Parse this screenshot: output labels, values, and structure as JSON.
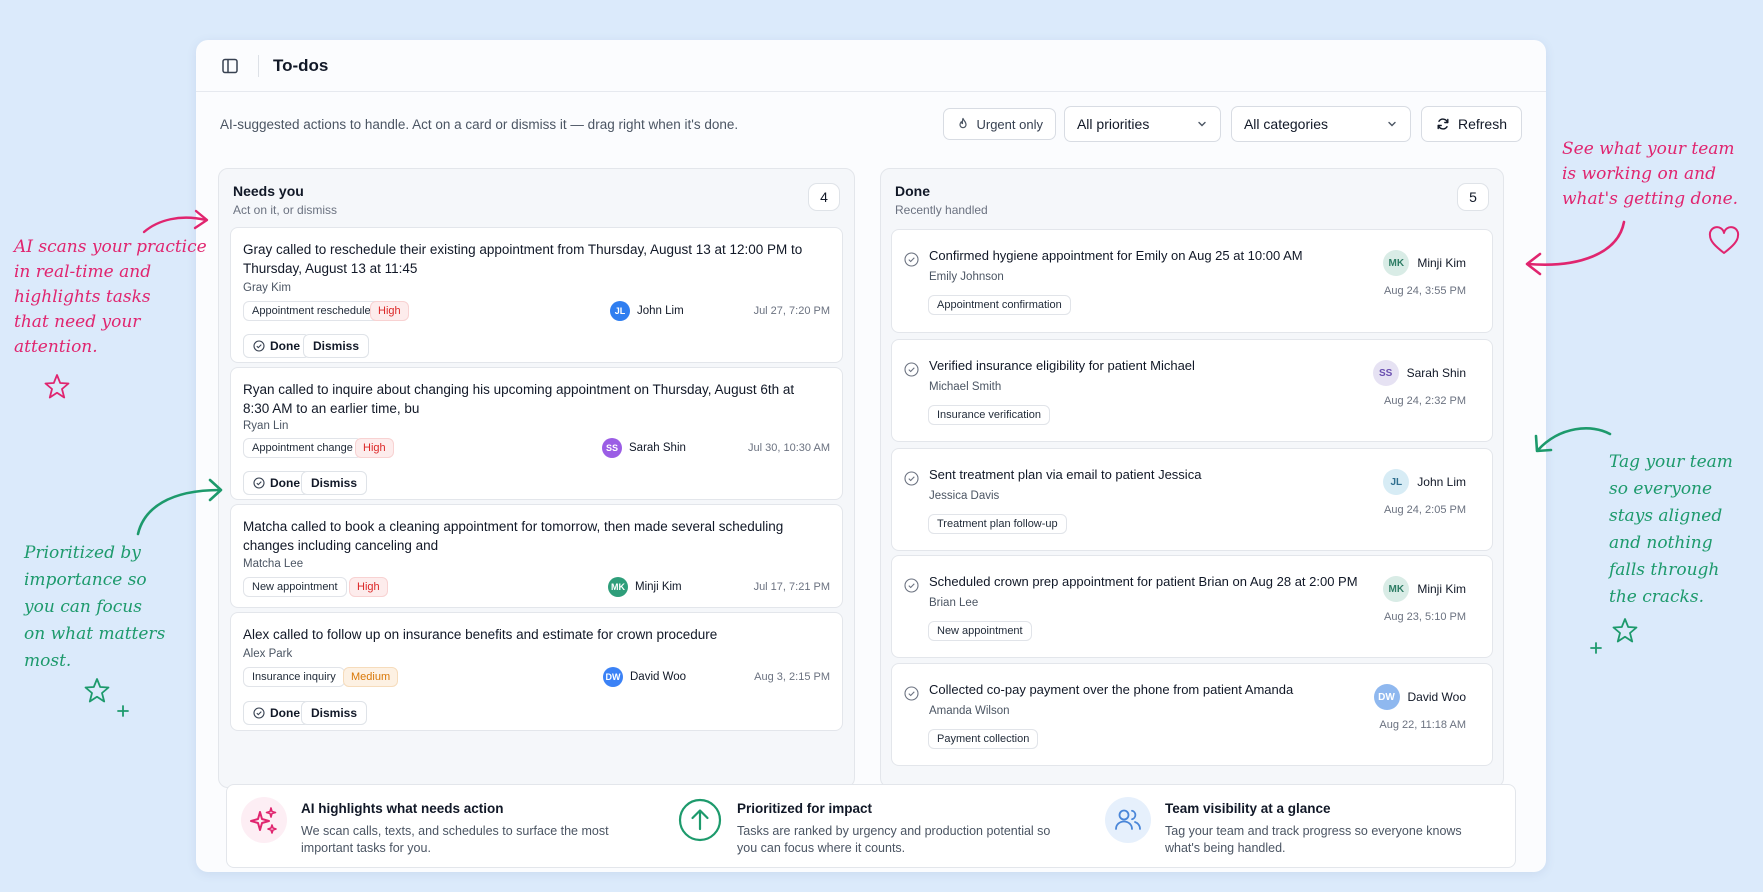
{
  "header": {
    "title": "To-dos"
  },
  "toolbar": {
    "subtitle": "AI-suggested actions to handle. Act on a card or dismiss it — drag right when it's done.",
    "urgent_label": "Urgent only",
    "priorities_value": "All priorities",
    "categories_value": "All categories",
    "refresh_label": "Refresh"
  },
  "needs_you": {
    "title": "Needs you",
    "subtitle": "Act on it, or dismiss",
    "count": "4",
    "done_label": "Done",
    "dismiss_label": "Dismiss",
    "cards": [
      {
        "text": "Gray called to reschedule their existing appointment from Thursday, August 13 at 12:00 PM to Thursday, August 13 at 11:45",
        "person": "Gray Kim",
        "tag": "Appointment reschedule",
        "priority": "High",
        "assignee": "John Lim",
        "initials": "JL",
        "time": "Jul 27, 7:20 PM"
      },
      {
        "text": "Ryan called to inquire about changing his upcoming appointment on Thursday, August 6th at 8:30 AM to an earlier time, bu",
        "person": "Ryan Lin",
        "tag": "Appointment change",
        "priority": "High",
        "assignee": "Sarah Shin",
        "initials": "SS",
        "time": "Jul 30, 10:30 AM"
      },
      {
        "text": "Matcha called to book a cleaning appointment for tomorrow, then made several scheduling changes including canceling and",
        "person": "Matcha Lee",
        "tag": "New appointment",
        "priority": "High",
        "assignee": "Minji Kim",
        "initials": "MK",
        "time": "Jul 17, 7:21 PM"
      },
      {
        "text": "Alex called to follow up on insurance benefits and estimate for crown procedure",
        "person": "Alex Park",
        "tag": "Insurance inquiry",
        "priority": "Medium",
        "assignee": "David Woo",
        "initials": "DW",
        "time": "Aug 3, 2:15 PM"
      }
    ]
  },
  "done": {
    "title": "Done",
    "subtitle": "Recently handled",
    "count": "5",
    "cards": [
      {
        "text": "Confirmed hygiene appointment for Emily on Aug 25 at 10:00 AM",
        "person": "Emily Johnson",
        "tag": "Appointment confirmation",
        "assignee": "Minji Kim",
        "initials": "MK",
        "time": "Aug 24, 3:55 PM"
      },
      {
        "text": "Verified insurance eligibility for patient Michael",
        "person": "Michael Smith",
        "tag": "Insurance verification",
        "assignee": "Sarah Shin",
        "initials": "SS",
        "time": "Aug 24, 2:32 PM"
      },
      {
        "text": "Sent treatment plan via email to patient Jessica",
        "person": "Jessica Davis",
        "tag": "Treatment plan follow-up",
        "assignee": "John Lim",
        "initials": "JL",
        "time": "Aug 24, 2:05 PM"
      },
      {
        "text": "Scheduled crown prep appointment for patient Brian on Aug 28 at 2:00 PM",
        "person": "Brian Lee",
        "tag": "New appointment",
        "assignee": "Minji Kim",
        "initials": "MK",
        "time": "Aug 23, 5:10 PM"
      },
      {
        "text": "Collected co-pay payment over the phone from patient Amanda",
        "person": "Amanda Wilson",
        "tag": "Payment collection",
        "assignee": "David Woo",
        "initials": "DW",
        "time": "Aug 22, 11:18 AM"
      }
    ]
  },
  "features": [
    {
      "title": "AI highlights what needs action",
      "desc": "We scan calls, texts, and schedules to surface the most important tasks for you.",
      "icon": "sparkles-icon"
    },
    {
      "title": "Prioritized for impact",
      "desc": "Tasks are ranked by urgency and production potential so you can focus where it counts.",
      "icon": "arrow-up-circle-icon"
    },
    {
      "title": "Team visibility at a glance",
      "desc": "Tag your team and track progress so everyone knows what's being handled.",
      "icon": "users-icon"
    }
  ],
  "annotations": {
    "ai_scan": [
      "AI scans your practice",
      "in real-time and",
      "highlights tasks",
      "that need your",
      "attention."
    ],
    "prioritized": [
      "Prioritized by",
      "importance so",
      "you can focus",
      "on what matters",
      "most."
    ],
    "team_work": [
      "See what your team",
      "is working on and",
      "what's getting done."
    ],
    "tag_team": [
      "Tag your team",
      "so everyone",
      "stays aligned",
      "and nothing",
      "falls through",
      "the cracks."
    ]
  },
  "colors": {
    "accent_pink": "#e0256f",
    "accent_green": "#1d9a6c",
    "high": "#dc2626",
    "medium": "#d97706",
    "avatar_jl": "#2f7ef0",
    "avatar_ss": "#9b5de5",
    "avatar_mk": "#2e9e7a",
    "avatar_dw": "#3b82f6"
  }
}
